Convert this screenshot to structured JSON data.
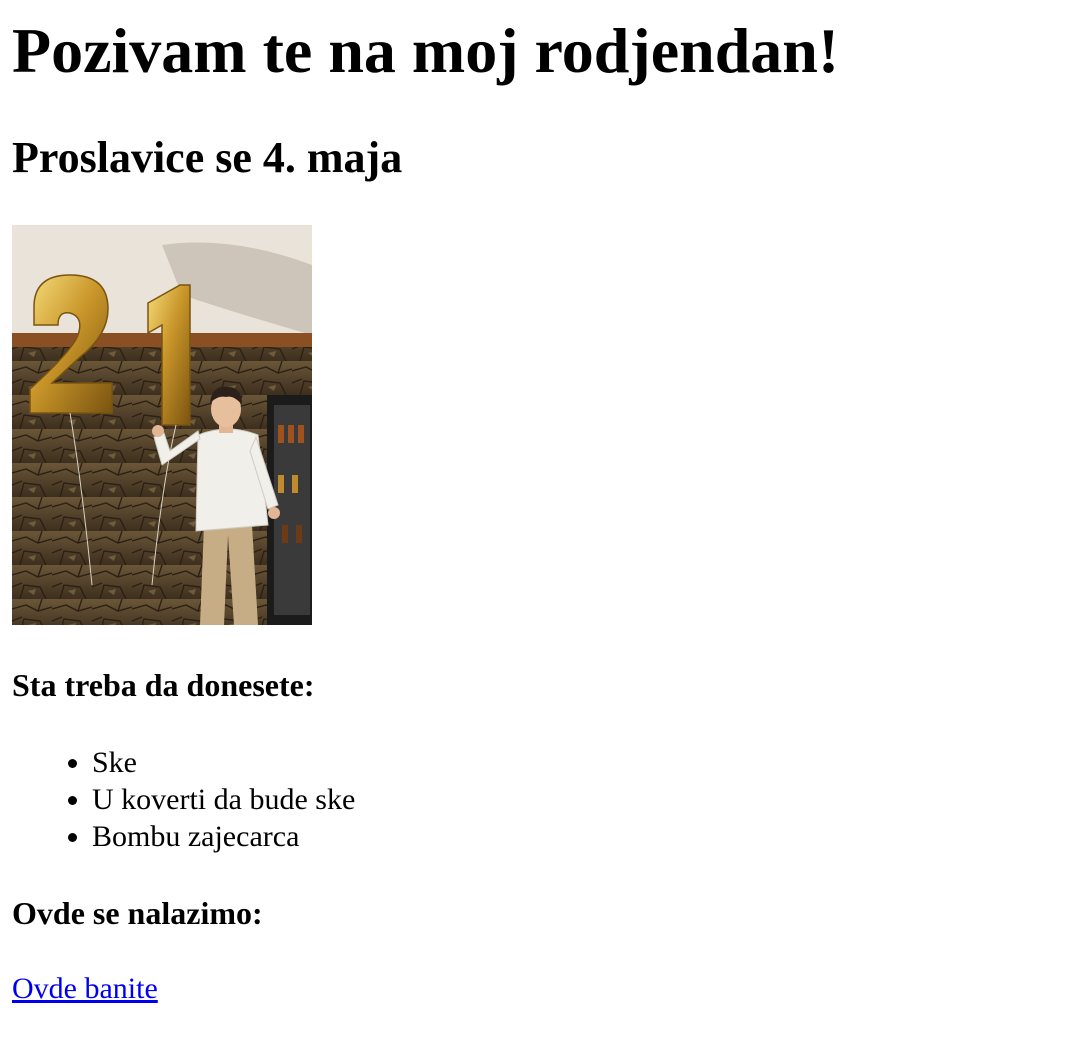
{
  "invitation": {
    "title": "Pozivam te na moj rodjendan!",
    "subtitle": "Proslavice se 4. maja"
  },
  "photo": {
    "balloon_number": "21",
    "balloon_color": "#d4a62a"
  },
  "bring_section": {
    "heading": "Sta treba da donesete:",
    "items": [
      "Ske",
      "U koverti da bude ske",
      "Bombu zajecarca"
    ]
  },
  "location_section": {
    "heading": "Ovde se nalazimo:",
    "link_label": "Ovde banite",
    "link_color": "#0000ee"
  }
}
